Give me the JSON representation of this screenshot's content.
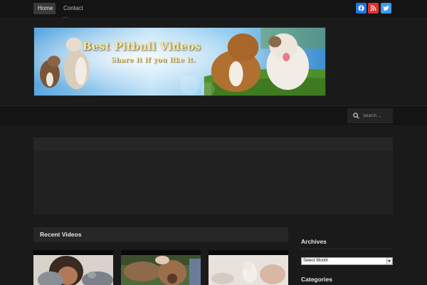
{
  "topnav": {
    "items": [
      {
        "label": "Home",
        "active": true
      },
      {
        "label": "Contact Us",
        "active": false
      }
    ]
  },
  "social": [
    {
      "icon": "facebook-icon",
      "color": "#1b78e6"
    },
    {
      "icon": "rss-icon",
      "color": "#e0322d"
    },
    {
      "icon": "twitter-icon",
      "color": "#3a9ee8"
    }
  ],
  "banner": {
    "title": "Best Pitbull Videos",
    "subtitle": "Share it if you like it."
  },
  "search": {
    "placeholder": "Search ..."
  },
  "recent": {
    "title": "Recent Videos"
  },
  "sidebar": {
    "archives_title": "Archives",
    "archives_select": "Select Month",
    "categories_title": "Categories"
  }
}
